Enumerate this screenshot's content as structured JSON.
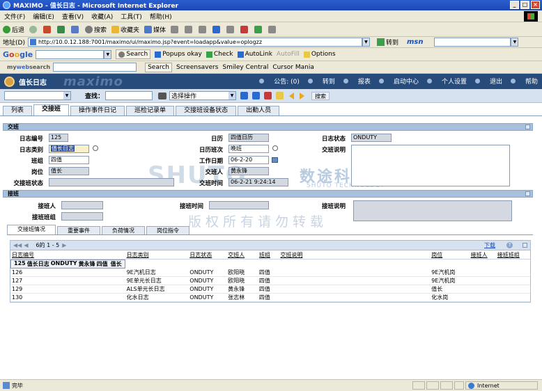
{
  "window": {
    "title": "MAXIMO - 值长日志 - Microsoft Internet Explorer"
  },
  "menu": [
    "文件(F)",
    "编辑(E)",
    "查看(V)",
    "收藏(A)",
    "工具(T)",
    "帮助(H)"
  ],
  "toolbar": {
    "back": "后退",
    "search": "搜索",
    "favorites": "收藏夹",
    "media": "媒体"
  },
  "address": {
    "label": "地址(D)",
    "url": "http://10.0.12.188:7001/maximo/ui/maximo.jsp?event=loadapp&value=oplogzz",
    "goto": "转到",
    "msn": "msn"
  },
  "google": {
    "logo_g": "G",
    "logo_o1": "o",
    "logo_o2": "o",
    "logo_rest": "gle",
    "search": "Search",
    "popups": "Popups okay",
    "check": "Check",
    "autolink": "AutoLink",
    "autofill": "AutoFill",
    "options": "Options"
  },
  "websearch": {
    "brand_prefix": "my",
    "brand_main": "web",
    "brand_suffix": "search",
    "search": "Search",
    "screensavers": "Screensavers",
    "smiley": "Smiley Central",
    "cursor": "Cursor Mania"
  },
  "maximo": {
    "app_title": "值长日志",
    "watermark": "maximo",
    "links": {
      "notice": "公告: (0)",
      "goto": "转到",
      "reports": "报表",
      "start_center": "启动中心",
      "profile": "个人设置",
      "signout": "退出",
      "help": "帮助"
    },
    "toolbar": {
      "find_label": "查找：",
      "action_select": "选择操作",
      "search_btn": "搜索"
    }
  },
  "tabs": [
    "列表",
    "交接班",
    "操作事件日记",
    "巡检记录单",
    "交接班设备状态",
    "出勤人员"
  ],
  "handover": {
    "section_title": "交班",
    "labels": {
      "log_no": "日志编号",
      "log_type": "日志类别",
      "shift_group": "班组",
      "position": "岗位",
      "handover_status": "交接班状态",
      "calendar": "日历",
      "calendar_shift": "日历班次",
      "work_date": "工作日期",
      "handover_person": "交班人",
      "handover_time": "交班时间",
      "log_status": "日志状态",
      "handover_note": "交班说明"
    },
    "values": {
      "log_no": "125",
      "log_type": "值长日志",
      "shift_group": "四值",
      "position": "值长",
      "handover_status": "",
      "calendar": "四值日历",
      "calendar_shift": "晚班",
      "work_date": "06-2-20",
      "handover_person": "黄永锋",
      "handover_time": "06-2-21 9:24:14",
      "log_status": "ONDUTY",
      "handover_note": ""
    }
  },
  "takeover": {
    "section_title": "接班",
    "labels": {
      "takeover_person": "接班人",
      "takeover_time": "接班时间",
      "takeover_note": "接班说明",
      "takeover_group": "接班班组"
    }
  },
  "watermarks": {
    "brand_en": "SHUTO",
    "brand_cn": "数途科技",
    "brand_sub": "SHUTO TECHNOLOGY",
    "copyright": "版权所有请勿转载"
  },
  "subtabs": [
    "交接班情况",
    "重要事件",
    "负荷情况",
    "岗位指令"
  ],
  "grid": {
    "page_info": "6的 1 - 5",
    "download": "下载",
    "help": "?",
    "columns": [
      "日志编号",
      "日志类别",
      "日志状态",
      "交班人",
      "班组",
      "交班说明",
      "岗位",
      "接班人",
      "接班班组"
    ],
    "rows": [
      [
        "125",
        "值长日志",
        "ONDUTY",
        "黄永锋",
        "四值",
        "",
        "值长",
        "",
        ""
      ],
      [
        "126",
        "9E汽机日志",
        "ONDUTY",
        "欧阳晓",
        "四值",
        "",
        "9E汽机岗",
        "",
        ""
      ],
      [
        "127",
        "9E单元长日志",
        "ONDUTY",
        "欧阳晓",
        "四值",
        "",
        "9E汽机岗",
        "",
        ""
      ],
      [
        "129",
        "ALS单元长日志",
        "ONDUTY",
        "黄永锋",
        "四值",
        "",
        "值长",
        "",
        ""
      ],
      [
        "130",
        "化水日志",
        "ONDUTY",
        "张志林",
        "四值",
        "",
        "化水岗",
        "",
        ""
      ]
    ],
    "selected_row": 0
  },
  "status": {
    "text": "完毕",
    "zone": "Internet"
  }
}
